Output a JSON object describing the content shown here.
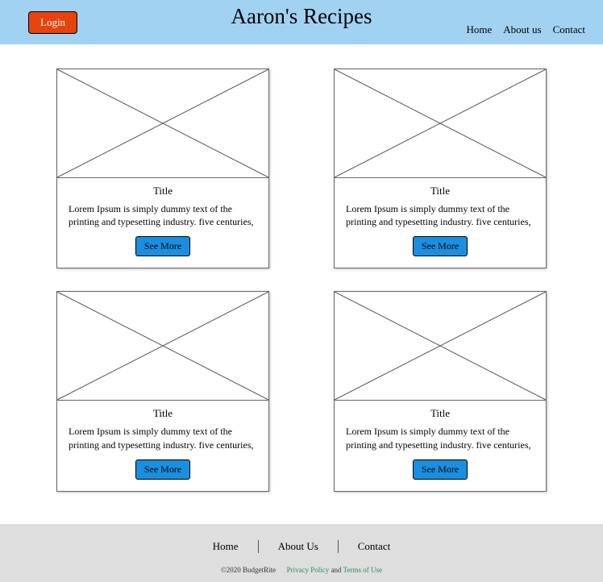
{
  "header": {
    "login_label": "Login",
    "site_title": "Aaron's Recipes",
    "nav": {
      "home": "Home",
      "about": "About us",
      "contact": "Contact"
    }
  },
  "cards": [
    {
      "title": "Title",
      "desc": "Lorem Ipsum is simply dummy text of the printing and typesetting industry. five centuries,",
      "button": "See More"
    },
    {
      "title": "Title",
      "desc": "Lorem Ipsum is simply dummy text of the printing and typesetting industry. five centuries,",
      "button": "See More"
    },
    {
      "title": "Title",
      "desc": "Lorem Ipsum is simply dummy text of the printing and typesetting industry. five centuries,",
      "button": "See More"
    },
    {
      "title": "Title",
      "desc": "Lorem Ipsum is simply dummy text of the printing and typesetting industry. five centuries,",
      "button": "See More"
    }
  ],
  "footer": {
    "nav": {
      "home": "Home",
      "about": "About Us",
      "contact": "Contact"
    },
    "copyright": "©2020 BudgetRite",
    "privacy": "Privacy Policy",
    "and": " and ",
    "terms": "Terms of Use"
  }
}
